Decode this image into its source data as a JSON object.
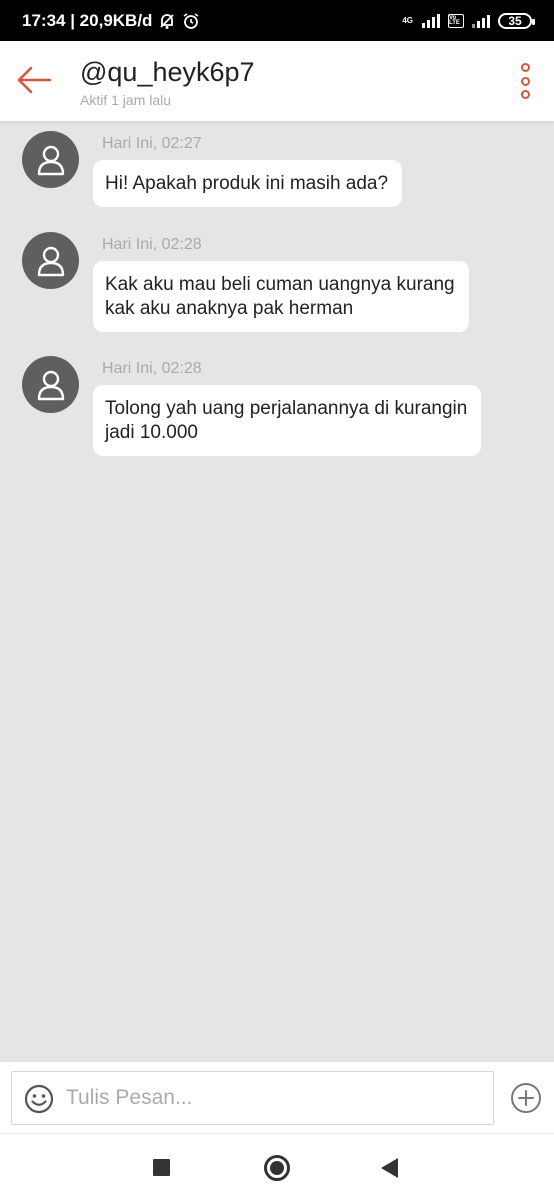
{
  "status_bar": {
    "time_speed": "17:34 | 20,9KB/d",
    "network_label": "4G",
    "volte_label": "Vo LTE",
    "battery": "35"
  },
  "header": {
    "title": "@qu_heyk6p7",
    "subtitle": "Aktif 1 jam lalu"
  },
  "messages": [
    {
      "time": "Hari Ini, 02:27",
      "lines": [
        "Hi! Apakah produk ini masih ada?"
      ]
    },
    {
      "time": "Hari Ini, 02:28",
      "lines": [
        "Kak aku mau beli cuman uangnya kurang",
        "kak aku anaknya pak herman"
      ]
    },
    {
      "time": "Hari Ini, 02:28",
      "lines": [
        "Tolong yah uang perjalanannya di kurangin",
        "jadi 10.000"
      ]
    }
  ],
  "input": {
    "placeholder": "Tulis Pesan..."
  },
  "icons": [
    "back-arrow-icon",
    "more-vertical-icon",
    "user-icon",
    "emoji-icon",
    "plus-circle-icon",
    "recents-icon",
    "home-icon",
    "back-triangle-icon"
  ],
  "colors": {
    "accent": "#d9553a",
    "chat_bg": "#e5e5e5",
    "avatar_bg": "#5f5f5f"
  }
}
